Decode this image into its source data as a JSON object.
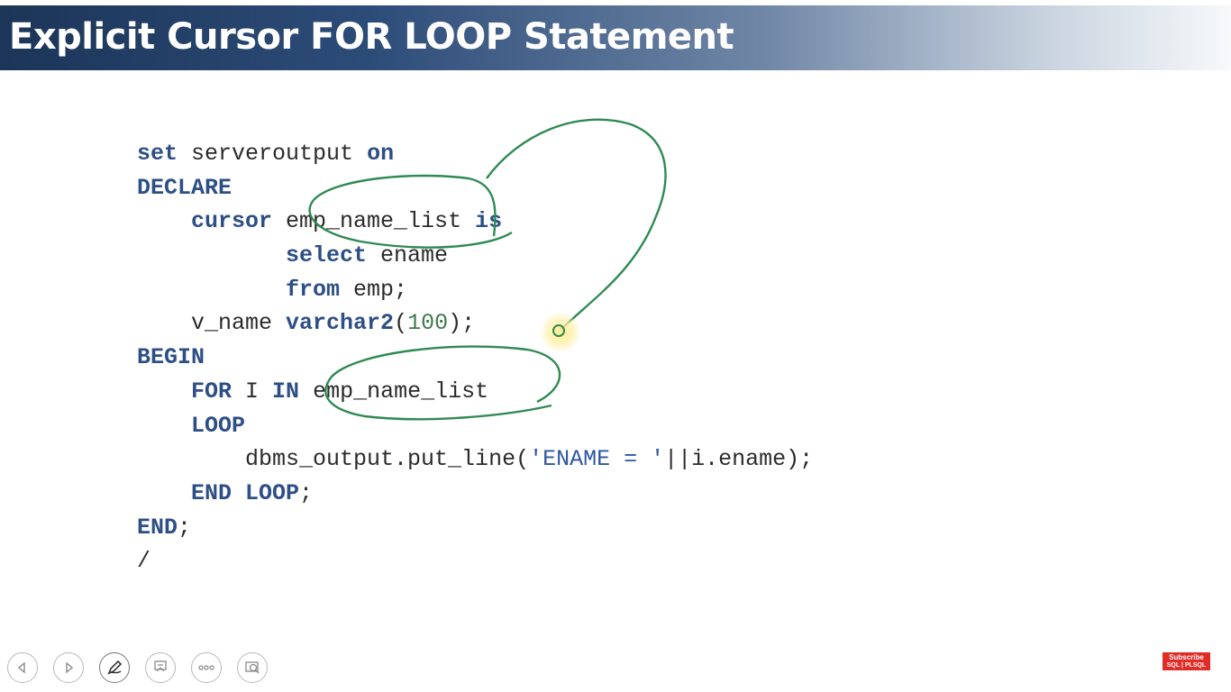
{
  "slide": {
    "title": "Explicit Cursor FOR LOOP Statement"
  },
  "code_lines": [
    [
      {
        "t": "set",
        "c": "kw"
      },
      {
        "t": " serveroutput ",
        "c": ""
      },
      {
        "t": "on",
        "c": "kw"
      }
    ],
    [
      {
        "t": "DECLARE",
        "c": "kw"
      }
    ],
    [
      {
        "t": "    ",
        "c": ""
      },
      {
        "t": "cursor",
        "c": "kw"
      },
      {
        "t": " emp_name_list ",
        "c": ""
      },
      {
        "t": "is",
        "c": "kw"
      }
    ],
    [
      {
        "t": "           ",
        "c": ""
      },
      {
        "t": "select",
        "c": "kw"
      },
      {
        "t": " ename",
        "c": ""
      }
    ],
    [
      {
        "t": "           ",
        "c": ""
      },
      {
        "t": "from",
        "c": "kw"
      },
      {
        "t": " emp;",
        "c": ""
      }
    ],
    [
      {
        "t": "    v_name ",
        "c": ""
      },
      {
        "t": "varchar2",
        "c": "kw"
      },
      {
        "t": "(",
        "c": ""
      },
      {
        "t": "100",
        "c": "num"
      },
      {
        "t": ");",
        "c": ""
      }
    ],
    [
      {
        "t": "BEGIN",
        "c": "kw"
      }
    ],
    [
      {
        "t": "    ",
        "c": ""
      },
      {
        "t": "FOR",
        "c": "kw"
      },
      {
        "t": " I ",
        "c": ""
      },
      {
        "t": "IN",
        "c": "kw"
      },
      {
        "t": " emp_name_list",
        "c": ""
      }
    ],
    [
      {
        "t": "    ",
        "c": ""
      },
      {
        "t": "LOOP",
        "c": "kw"
      }
    ],
    [
      {
        "t": "        dbms_output.put_line(",
        "c": ""
      },
      {
        "t": "'ENAME = '",
        "c": "str"
      },
      {
        "t": "||i.ename);",
        "c": ""
      }
    ],
    [
      {
        "t": "    ",
        "c": ""
      },
      {
        "t": "END LOOP",
        "c": "kw"
      },
      {
        "t": ";",
        "c": ""
      }
    ],
    [
      {
        "t": "END",
        "c": "kw"
      },
      {
        "t": ";",
        "c": ""
      }
    ],
    [
      {
        "t": "/",
        "c": ""
      }
    ]
  ],
  "toolbar": {
    "buttons": [
      {
        "name": "previous-slide-button",
        "icon": "triangle-left-icon"
      },
      {
        "name": "next-slide-button",
        "icon": "triangle-right-icon"
      },
      {
        "name": "pen-tool-button",
        "icon": "pen-icon"
      },
      {
        "name": "see-all-slides-button",
        "icon": "slides-icon"
      },
      {
        "name": "more-options-button",
        "icon": "ellipsis-icon"
      },
      {
        "name": "zoom-button",
        "icon": "zoom-icon"
      }
    ]
  },
  "badge": {
    "line1": "Subscribe",
    "line2": "SQL | PLSQL",
    "color": "#e12b25"
  },
  "colors": {
    "keyword": "#2d4f86",
    "number": "#3d7a4e",
    "string": "#2e57a0",
    "ink": "#2f8a52"
  }
}
